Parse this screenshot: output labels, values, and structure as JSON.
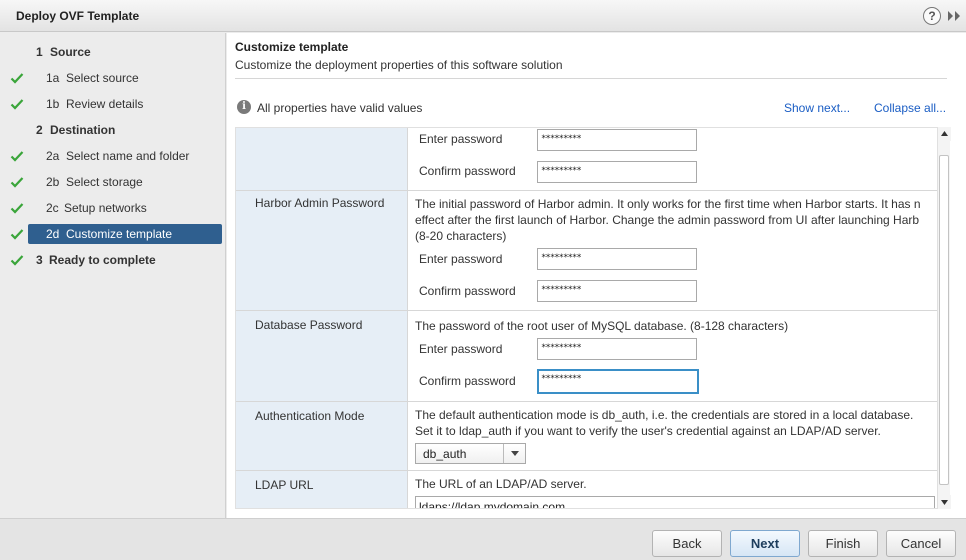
{
  "window": {
    "title": "Deploy OVF Template",
    "help_glyph": "?"
  },
  "nav": {
    "items": [
      {
        "num": "1",
        "label": "Source",
        "checked": false,
        "group": true
      },
      {
        "num": "1a",
        "label": "Select source",
        "checked": true,
        "group": false
      },
      {
        "num": "1b",
        "label": "Review details",
        "checked": true,
        "group": false
      },
      {
        "num": "2",
        "label": "Destination",
        "checked": false,
        "group": true
      },
      {
        "num": "2a",
        "label": "Select name and folder",
        "checked": true,
        "group": false
      },
      {
        "num": "2b",
        "label": "Select storage",
        "checked": true,
        "group": false
      },
      {
        "num": "2c",
        "label": "Setup networks",
        "checked": true,
        "group": false
      },
      {
        "num": "2d",
        "label": "Customize template",
        "checked": true,
        "group": false,
        "selected": true
      },
      {
        "num": "3",
        "label": "Ready to complete",
        "checked": true,
        "group": true
      }
    ]
  },
  "main": {
    "heading": "Customize template",
    "subheading": "Customize the deployment properties of this software solution",
    "status": "All properties have valid values",
    "show_next": "Show next...",
    "collapse_all": "Collapse all...",
    "properties": {
      "top_row": {
        "enter_label": "Enter password",
        "enter_value": "*********",
        "confirm_label": "Confirm password",
        "confirm_value": "*********"
      },
      "harbor_admin": {
        "name": "Harbor Admin Password",
        "desc_line1": "The initial password of Harbor admin. It only works for the first time when Harbor starts. It has n",
        "desc_line2": "effect after the first launch of Harbor. Change the admin password from UI after launching Harb",
        "desc_line3": "(8-20 characters)",
        "enter_label": "Enter password",
        "enter_value": "*********",
        "confirm_label": "Confirm password",
        "confirm_value": "*********"
      },
      "database": {
        "name": "Database Password",
        "desc": "The password of the root user of MySQL database.  (8-128 characters)",
        "enter_label": "Enter password",
        "enter_value": "*********",
        "confirm_label": "Confirm password",
        "confirm_value": "*********"
      },
      "auth_mode": {
        "name": "Authentication Mode",
        "desc_line1": "The default authentication mode is db_auth, i.e. the credentials are stored in a local database.",
        "desc_line2": "Set it to ldap_auth if you want to verify the user's credential against an LDAP/AD server.",
        "selected": "db_auth"
      },
      "ldap_url": {
        "name": "LDAP URL",
        "desc": "The URL of an LDAP/AD server.",
        "value": "ldaps://ldap.mydomain.com"
      }
    }
  },
  "footer": {
    "back": "Back",
    "next": "Next",
    "finish": "Finish",
    "cancel": "Cancel"
  },
  "colors": {
    "selected_nav": "#2f5f8f",
    "check_green": "#3aa53a",
    "link": "#1a5dc4",
    "name_col_bg": "#e6eef6",
    "focus_border": "#3a8fc7"
  }
}
